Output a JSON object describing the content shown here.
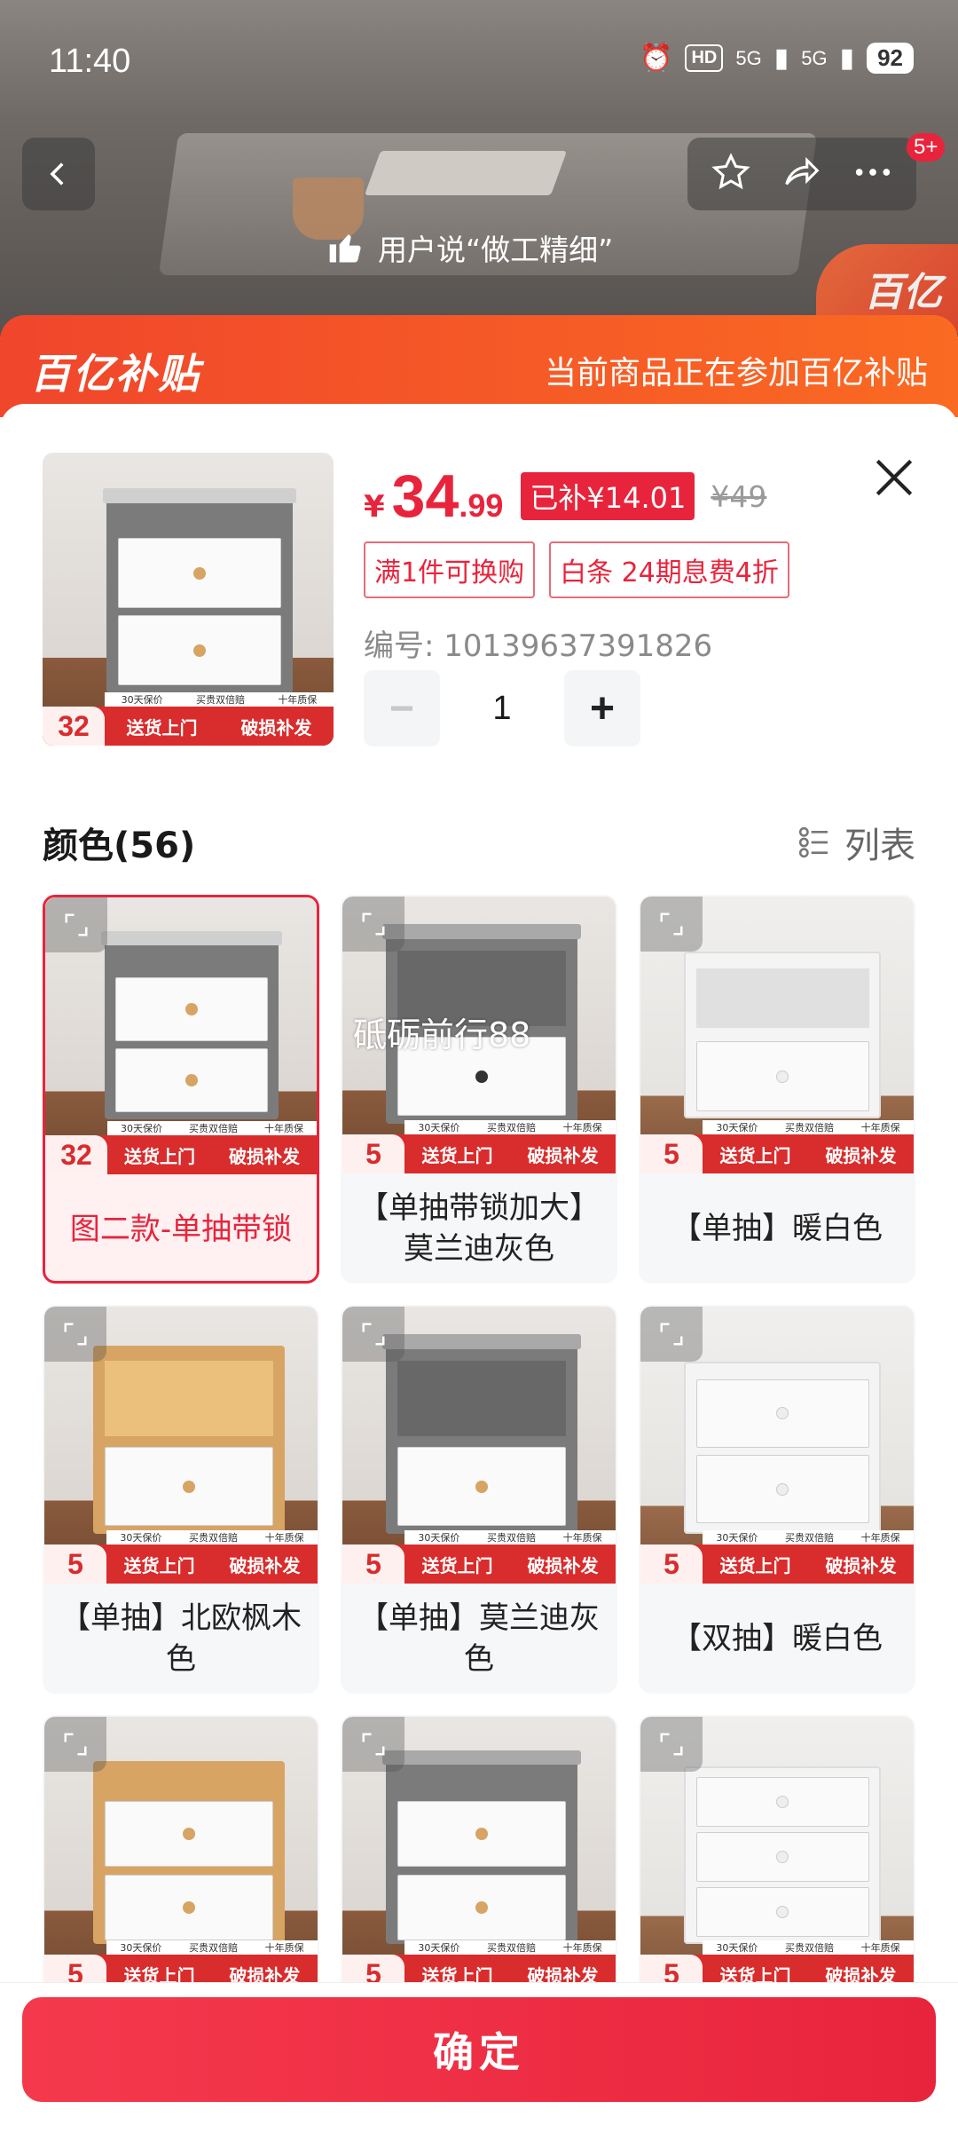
{
  "status_bar": {
    "time": "11:40",
    "hd_label": "HD",
    "signal1": "5G",
    "signal2": "5G",
    "battery": "92"
  },
  "header": {
    "badge_count": "5+",
    "review_text": "用户说“做工精细”",
    "logo_text": "百亿"
  },
  "subsidy_bar": {
    "logo": "百亿补贴",
    "note": "当前商品正在参加百亿补贴"
  },
  "product": {
    "currency": "¥",
    "price_int": "34",
    "price_dec": ".99",
    "subsidy_tag": "已补¥14.01",
    "original_price": "¥49",
    "promo_tags": [
      "满1件可换购",
      "白条 24期息费4折"
    ],
    "sku_code": "编号: 10139637391826",
    "quantity": "1",
    "minus": "−",
    "plus": "+"
  },
  "color_section": {
    "title": "颜色(56)",
    "list_toggle": "列表"
  },
  "banner": {
    "line_top": [
      "30天保价",
      "买贵双倍赔",
      "十年质保"
    ],
    "left": "送货上门",
    "right": "破损补发"
  },
  "options": [
    {
      "label": "图二款-单抽带锁",
      "badge": "32",
      "selected": true,
      "overlay": ""
    },
    {
      "label": "【单抽带锁加大】莫兰迪灰色",
      "badge": "5",
      "selected": false,
      "overlay": "砥砺前行88"
    },
    {
      "label": "【单抽】暖白色",
      "badge": "5",
      "selected": false,
      "overlay": ""
    },
    {
      "label": "【单抽】北欧枫木色",
      "badge": "5",
      "selected": false,
      "overlay": ""
    },
    {
      "label": "【单抽】莫兰迪灰色",
      "badge": "5",
      "selected": false,
      "overlay": ""
    },
    {
      "label": "【双抽】暖白色",
      "badge": "5",
      "selected": false,
      "overlay": ""
    },
    {
      "label": "",
      "badge": "5",
      "selected": false,
      "overlay": ""
    },
    {
      "label": "",
      "badge": "5",
      "selected": false,
      "overlay": ""
    },
    {
      "label": "",
      "badge": "5",
      "selected": false,
      "overlay": ""
    }
  ],
  "footer": {
    "confirm": "确定"
  },
  "colors": {
    "accent": "#e8243c",
    "subsidy_orange": "#fa6a22"
  }
}
